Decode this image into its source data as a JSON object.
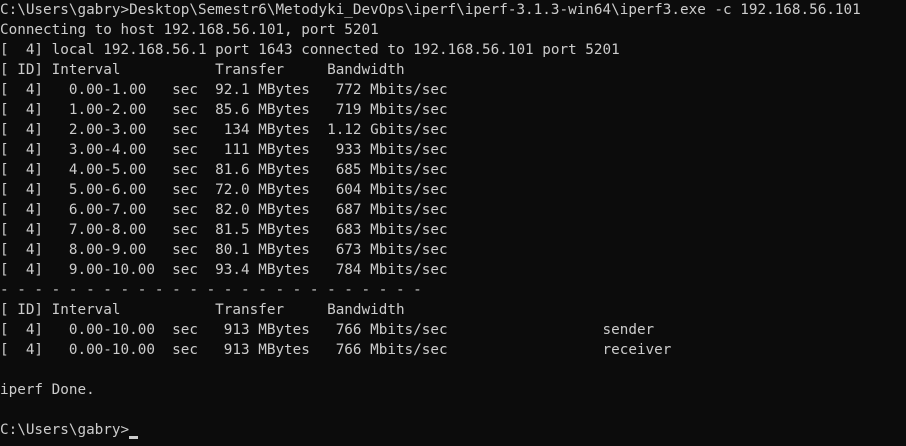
{
  "terminal": {
    "lines": [
      "C:\\Users\\gabry>Desktop\\Semestr6\\Metodyki_DevOps\\iperf\\iperf-3.1.3-win64\\iperf3.exe -c 192.168.56.101",
      "Connecting to host 192.168.56.101, port 5201",
      "[  4] local 192.168.56.1 port 1643 connected to 192.168.56.101 port 5201",
      "[ ID] Interval           Transfer     Bandwidth",
      "[  4]   0.00-1.00   sec  92.1 MBytes   772 Mbits/sec",
      "[  4]   1.00-2.00   sec  85.6 MBytes   719 Mbits/sec",
      "[  4]   2.00-3.00   sec   134 MBytes  1.12 Gbits/sec",
      "[  4]   3.00-4.00   sec   111 MBytes   933 Mbits/sec",
      "[  4]   4.00-5.00   sec  81.6 MBytes   685 Mbits/sec",
      "[  4]   5.00-6.00   sec  72.0 MBytes   604 Mbits/sec",
      "[  4]   6.00-7.00   sec  82.0 MBytes   687 Mbits/sec",
      "[  4]   7.00-8.00   sec  81.5 MBytes   683 Mbits/sec",
      "[  4]   8.00-9.00   sec  80.1 MBytes   673 Mbits/sec",
      "[  4]   9.00-10.00  sec  93.4 MBytes   784 Mbits/sec",
      "- - - - - - - - - - - - - - - - - - - - - - - - -",
      "[ ID] Interval           Transfer     Bandwidth",
      "[  4]   0.00-10.00  sec   913 MBytes   766 Mbits/sec                  sender",
      "[  4]   0.00-10.00  sec   913 MBytes   766 Mbits/sec                  receiver",
      "",
      "iperf Done.",
      ""
    ],
    "prompt": "C:\\Users\\gabry>"
  },
  "colors": {
    "background": "#0c0c0c",
    "text": "#cccccc"
  }
}
